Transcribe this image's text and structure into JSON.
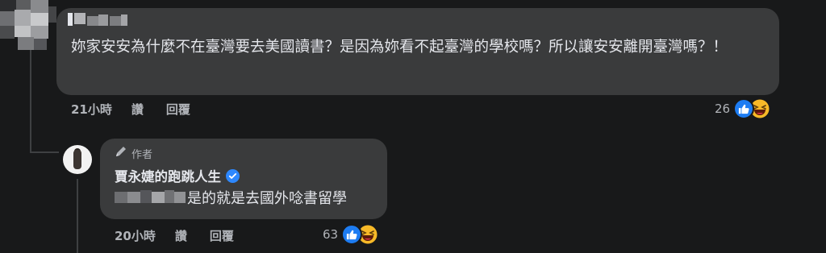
{
  "comment": {
    "text": "妳家安安為什麼不在臺灣要去美國讀書？是因為妳看不起臺灣的學校嗎？所以讓安安離開臺灣嗎？！",
    "time": "21小時",
    "like_label": "讚",
    "reply_label": "回覆",
    "reaction_count": "26"
  },
  "reply": {
    "author_badge": "作者",
    "author_name": "賈永婕的跑跳人生",
    "text": "是的就是去國外唸書留學",
    "time": "20小時",
    "like_label": "讚",
    "reply_label": "回覆",
    "reaction_count": "63"
  },
  "icons": {
    "like": "thumbs-up-icon",
    "haha": "laughing-face-icon",
    "pen": "pen-icon",
    "verified": "verified-badge-icon"
  },
  "colors": {
    "background": "#18191a",
    "bubble": "#3a3b3c",
    "text": "#e4e6eb",
    "secondary_text": "#b0b3b8",
    "like_blue": "#1d7cf2",
    "verified_blue": "#2d88ff"
  }
}
